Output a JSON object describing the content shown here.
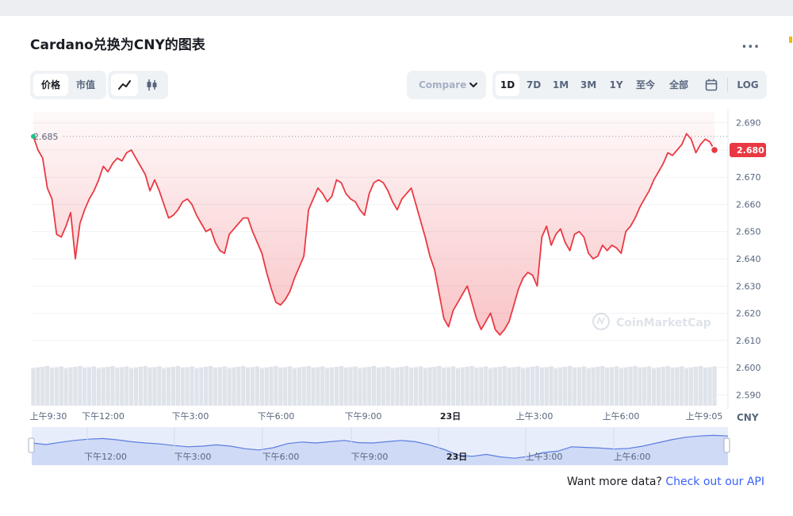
{
  "header": {
    "title": "Cardano兑换为CNY的图表",
    "more_label": "..."
  },
  "controls": {
    "view_tabs": [
      "价格",
      "市值"
    ],
    "chart_styles": [
      "line-chart-icon",
      "candlestick-icon"
    ],
    "compare_label": "Compare",
    "ranges": [
      "1D",
      "7D",
      "1M",
      "3M",
      "1Y",
      "至今",
      "全部"
    ],
    "active_range": "1D",
    "calendar_icon": "calendar-icon",
    "log_label": "LOG"
  },
  "watermark": "CoinMarketCap",
  "footer": {
    "text": "Want more data?",
    "link": "Check out our API"
  },
  "colors": {
    "line": "#ea3943",
    "up": "#16c784",
    "accent": "#3861fb",
    "nav_line": "#5b7ee0"
  },
  "chart_data": {
    "type": "line",
    "currency": "CNY",
    "y_ticks": [
      "2.690",
      "2.680",
      "2.670",
      "2.660",
      "2.650",
      "2.640",
      "2.630",
      "2.620",
      "2.610",
      "2.600",
      "2.590"
    ],
    "ylim": [
      2.586,
      2.694
    ],
    "x_ticks": [
      "上午9:30",
      "下午12:00",
      "下午3:00",
      "下午6:00",
      "下午9:00",
      "23日",
      "上午3:00",
      "上午6:00",
      "上午9:05"
    ],
    "navigator_ticks": [
      "下午12:00",
      "下午3:00",
      "下午6:00",
      "下午9:00",
      "23日",
      "上午3:00",
      "上午6:00"
    ],
    "open_price": "2.685",
    "current_price": "2.680",
    "grid": true,
    "series": [
      {
        "values": [
          2.685,
          2.68,
          2.677,
          2.666,
          2.662,
          2.649,
          2.648,
          2.652,
          2.657,
          2.64,
          2.653,
          2.658,
          2.662,
          2.665,
          2.669,
          2.674,
          2.672,
          2.675,
          2.677,
          2.676,
          2.679,
          2.68,
          2.677,
          2.674,
          2.671,
          2.665,
          2.669,
          2.665,
          2.66,
          2.655,
          2.656,
          2.658,
          2.661,
          2.662,
          2.66,
          2.656,
          2.653,
          2.65,
          2.651,
          2.646,
          2.643,
          2.642,
          2.649,
          2.651,
          2.653,
          2.655,
          2.655,
          2.65,
          2.646,
          2.642,
          2.635,
          2.629,
          2.624,
          2.623,
          2.625,
          2.628,
          2.633,
          2.637,
          2.641,
          2.658,
          2.662,
          2.666,
          2.664,
          2.661,
          2.663,
          2.669,
          2.668,
          2.664,
          2.662,
          2.661,
          2.658,
          2.656,
          2.664,
          2.668,
          2.669,
          2.668,
          2.665,
          2.661,
          2.658,
          2.662,
          2.664,
          2.666,
          2.66,
          2.654,
          2.648,
          2.641,
          2.636,
          2.627,
          2.618,
          2.615,
          2.621,
          2.624,
          2.627,
          2.63,
          2.624,
          2.618,
          2.614,
          2.617,
          2.62,
          2.614,
          2.612,
          2.614,
          2.617,
          2.623,
          2.629,
          2.633,
          2.635,
          2.634,
          2.63,
          2.648,
          2.652,
          2.645,
          2.649,
          2.651,
          2.646,
          2.643,
          2.649,
          2.65,
          2.648,
          2.642,
          2.64,
          2.641,
          2.645,
          2.643,
          2.645,
          2.644,
          2.642,
          2.65,
          2.652,
          2.655,
          2.659,
          2.662,
          2.665,
          2.669,
          2.672,
          2.675,
          2.679,
          2.678,
          2.68,
          2.682,
          2.686,
          2.684,
          2.679,
          2.682,
          2.684,
          2.683,
          2.68
        ]
      }
    ],
    "navigator_values": [
      2.66,
      2.655,
      2.662,
      2.668,
      2.672,
      2.674,
      2.67,
      2.664,
      2.66,
      2.657,
      2.652,
      2.648,
      2.65,
      2.654,
      2.65,
      2.642,
      2.638,
      2.645,
      2.658,
      2.663,
      2.66,
      2.664,
      2.668,
      2.661,
      2.66,
      2.664,
      2.668,
      2.664,
      2.654,
      2.64,
      2.622,
      2.618,
      2.624,
      2.616,
      2.612,
      2.618,
      2.63,
      2.634,
      2.648,
      2.646,
      2.644,
      2.641,
      2.643,
      2.65,
      2.66,
      2.67,
      2.678,
      2.682,
      2.684,
      2.682
    ]
  }
}
